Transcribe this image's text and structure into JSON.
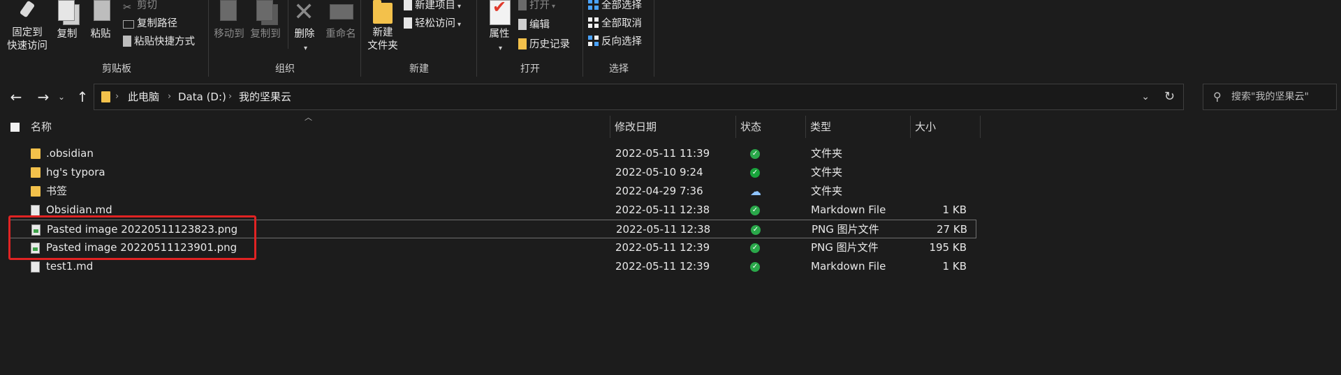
{
  "ribbon": {
    "clipboard": {
      "label": "剪贴板",
      "pin": "固定到\n快速访问",
      "copy": "复制",
      "paste": "粘贴",
      "cut": "剪切",
      "copy_path": "复制路径",
      "paste_shortcut": "粘贴快捷方式"
    },
    "organize": {
      "label": "组织",
      "move_to": "移动到",
      "copy_to": "复制到",
      "delete": "删除",
      "rename": "重命名"
    },
    "new": {
      "label": "新建",
      "new_folder": "新建\n文件夹",
      "new_item": "新建项目",
      "easy_access": "轻松访问"
    },
    "open": {
      "label": "打开",
      "properties": "属性",
      "open": "打开",
      "edit": "编辑",
      "history": "历史记录"
    },
    "select": {
      "label": "选择",
      "select_all": "全部选择",
      "select_none": "全部取消",
      "invert": "反向选择"
    }
  },
  "nav": {
    "back": "←",
    "forward": "→",
    "recent": "⌄",
    "up": "↑",
    "crumbs": [
      "此电脑",
      "Data (D:)",
      "我的坚果云"
    ],
    "refresh": "↻",
    "dropdown": "⌄"
  },
  "search": {
    "placeholder": "搜索\"我的坚果云\""
  },
  "columns": {
    "name": "名称",
    "date": "修改日期",
    "status": "状态",
    "type": "类型",
    "size": "大小"
  },
  "files": [
    {
      "name": ".obsidian",
      "date": "2022-05-11 11:39",
      "status": "synced",
      "type": "文件夹",
      "size": "",
      "icon": "folder-icon"
    },
    {
      "name": "hg's typora",
      "date": "2022-05-10 9:24",
      "status": "synced",
      "type": "文件夹",
      "size": "",
      "icon": "folder-icon"
    },
    {
      "name": "书签",
      "date": "2022-04-29 7:36",
      "status": "cloud",
      "type": "文件夹",
      "size": "",
      "icon": "folder-icon"
    },
    {
      "name": "Obsidian.md",
      "date": "2022-05-11 12:38",
      "status": "synced",
      "type": "Markdown File",
      "size": "1 KB",
      "icon": "md-file-icon"
    },
    {
      "name": "Pasted image 20220511123823.png",
      "date": "2022-05-11 12:38",
      "status": "synced",
      "type": "PNG 图片文件",
      "size": "27 KB",
      "icon": "png-file-icon"
    },
    {
      "name": "Pasted image 20220511123901.png",
      "date": "2022-05-11 12:39",
      "status": "synced",
      "type": "PNG 图片文件",
      "size": "195 KB",
      "icon": "png-file-icon"
    },
    {
      "name": "test1.md",
      "date": "2022-05-11 12:39",
      "status": "synced",
      "type": "Markdown File",
      "size": "1 KB",
      "icon": "md-file-icon"
    }
  ],
  "colors": {
    "background": "#1c1c1c",
    "highlight_box": "#e02323",
    "sync_ok": "#2aa84a",
    "folder": "#f3c14b"
  }
}
